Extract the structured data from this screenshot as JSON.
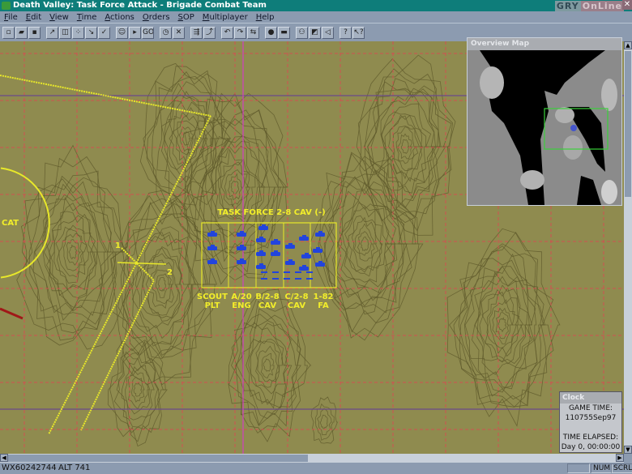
{
  "window": {
    "title": "Death Valley:  Task Force Attack - Brigade Combat Team",
    "watermark_left": "GRY",
    "watermark_right": "OnLine"
  },
  "menu": [
    "File",
    "Edit",
    "View",
    "Time",
    "Actions",
    "Orders",
    "SOP",
    "Multiplayer",
    "Help"
  ],
  "toolbar": {
    "groups": [
      [
        {
          "icon": "new-file-icon",
          "g": "▫"
        },
        {
          "icon": "open-folder-icon",
          "g": "▰"
        },
        {
          "icon": "save-icon",
          "g": "▪"
        }
      ],
      [
        {
          "icon": "move-unit-icon",
          "g": "↗"
        },
        {
          "icon": "unit-icon",
          "g": "◫"
        },
        {
          "icon": "formation-icon",
          "g": "⁘"
        },
        {
          "icon": "route-icon",
          "g": "↘"
        },
        {
          "icon": "check-icon",
          "g": "✓"
        }
      ],
      [
        {
          "icon": "commander-portrait-icon",
          "g": "☺"
        },
        {
          "icon": "pointer-icon",
          "g": "▸"
        },
        {
          "icon": "go-icon",
          "g": "GO"
        }
      ],
      [
        {
          "icon": "stopwatch-icon",
          "g": "◷"
        },
        {
          "icon": "cancel-icon",
          "g": "✕"
        }
      ],
      [
        {
          "icon": "attack-icon",
          "g": "⇶"
        },
        {
          "icon": "advance-icon",
          "g": "⤴"
        }
      ],
      [
        {
          "icon": "turn-left-icon",
          "g": "↶"
        },
        {
          "icon": "turn-right-icon",
          "g": "↷"
        },
        {
          "icon": "withdraw-icon",
          "g": "⇆"
        }
      ],
      [
        {
          "icon": "stop-icon",
          "g": "●"
        },
        {
          "icon": "hold-icon",
          "g": "▬"
        }
      ],
      [
        {
          "icon": "binoculars-icon",
          "g": "⚇"
        },
        {
          "icon": "report-icon",
          "g": "◩"
        },
        {
          "icon": "sound-icon",
          "g": "◁"
        }
      ],
      [
        {
          "icon": "help-icon",
          "g": "?"
        },
        {
          "icon": "context-help-icon",
          "g": "↖?"
        }
      ]
    ]
  },
  "map": {
    "task_force_label": "TASK FORCE 2-8 CAV (-)",
    "units": [
      {
        "line1": "SCOUT",
        "line2": "PLT"
      },
      {
        "line1": "A/20",
        "line2": "ENG"
      },
      {
        "line1": "B/2-8",
        "line2": "CAV"
      },
      {
        "line1": "C/2-8",
        "line2": "CAV"
      },
      {
        "line1": "1-82",
        "line2": "FA"
      }
    ],
    "objective_label": "CAT",
    "phase_labels": [
      "1",
      "2"
    ],
    "colors": {
      "terrain": "#8f8b4f",
      "contour": "#5f5a2c",
      "grid": "#d05050",
      "overlay": "#e8e82a",
      "friendly": "#2244dd"
    }
  },
  "overview": {
    "title": "Overview Map"
  },
  "clock": {
    "title": "Clock",
    "game_time_label": "GAME TIME:",
    "game_time": "110755Sep97",
    "elapsed_label": "TIME ELAPSED:",
    "elapsed": "Day 0, 00:00:00"
  },
  "status": {
    "grid": "WX60242744",
    "alt": "ALT 741",
    "num": "NUM",
    "scrl": "SCRL"
  }
}
